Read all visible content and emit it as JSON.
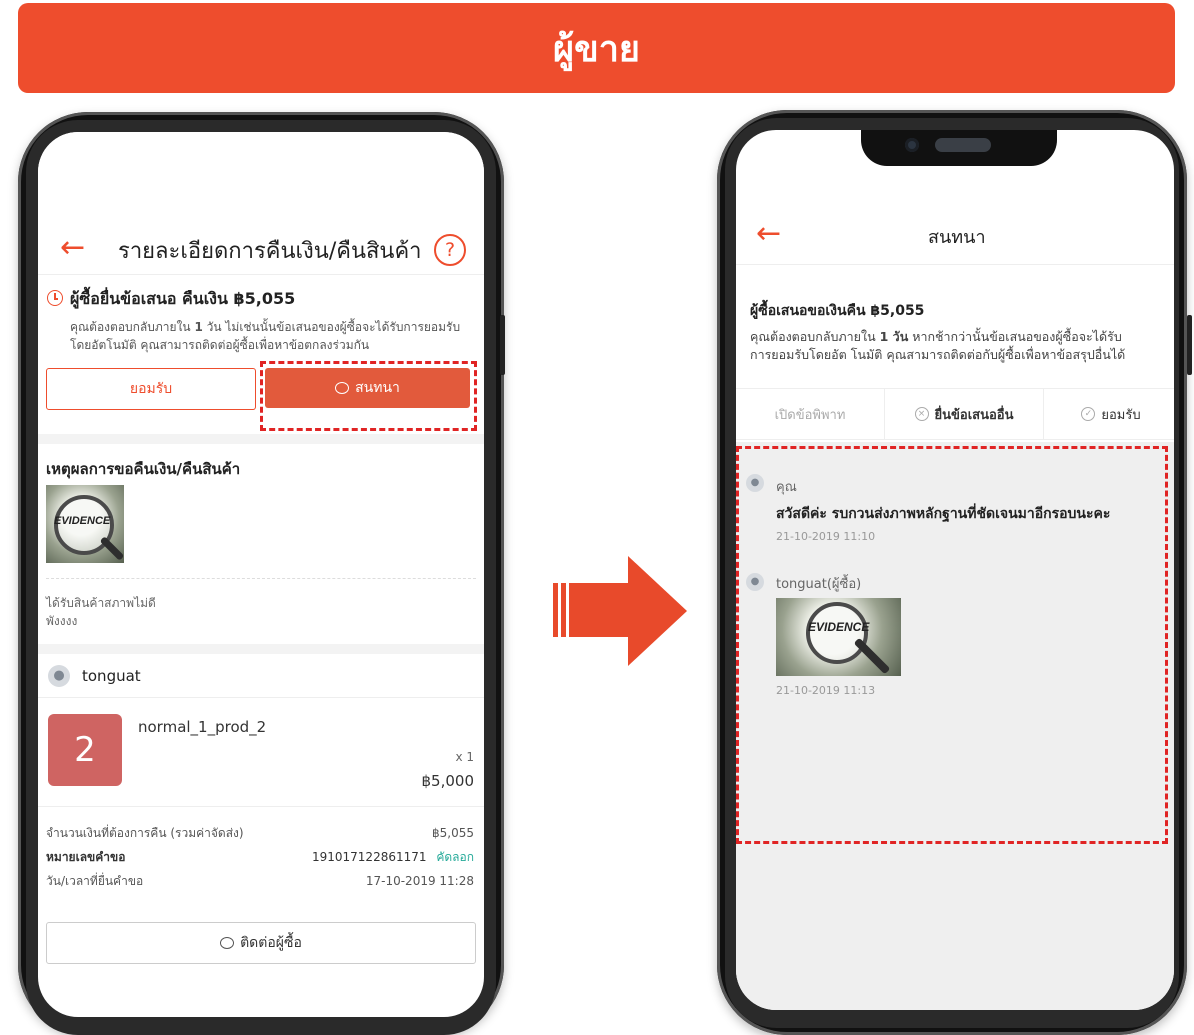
{
  "banner": {
    "title": "ผู้ขาย"
  },
  "left": {
    "header": {
      "title": "รายละเอียดการคืนเงิน/คืนสินค้า",
      "help_label": "?"
    },
    "status": {
      "title": "ผู้ซื้อยื่นข้อเสนอ คืนเงิน ฿5,055",
      "desc_line1_a": "คุณต้องตอบกลับภายใน ",
      "desc_days": "1",
      "desc_line1_b": " วัน ไม่เช่นนั้นข้อเสนอของผู้ซื้อจะได้รับการยอมรับ",
      "desc_line2": "โดยอัตโนมัติ คุณสามารถติดต่อผู้ซื้อเพื่อหาข้อตกลงร่วมกัน"
    },
    "buttons": {
      "accept": "ยอมรับ",
      "chat": "สนทนา"
    },
    "reason": {
      "heading": "เหตุผลการขอคืนเงิน/คืนสินค้า",
      "evidence_text": "EVIDENCE",
      "line1": "ได้รับสินค้าสภาพไม่ดี",
      "line2": "พังงงง"
    },
    "buyer": {
      "name": "tonguat"
    },
    "product": {
      "thumb_label": "2",
      "name": "normal_1_prod_2",
      "qty": "x 1",
      "price": "฿5,000"
    },
    "summary": {
      "refund_label": "จำนวนเงินที่ต้องการคืน (รวมค่าจัดส่ง)",
      "refund_value": "฿5,055",
      "request_label": "หมายเลขคำขอ",
      "request_value": "191017122861171",
      "copy_label": "คัดลอก",
      "time_label": "วัน/เวลาที่ยื่นคำขอ",
      "time_value": "17-10-2019 11:28"
    },
    "contact_button": "ติดต่อผู้ซื้อ"
  },
  "right": {
    "header": {
      "title": "สนทนา"
    },
    "offer": {
      "title": "ผู้ซื้อเสนอขอเงินคืน ฿5,055",
      "desc_line1_a": "คุณต้องตอบกลับภายใน ",
      "desc_days": "1 วัน",
      "desc_line1_b": " หากช้ากว่านั้นข้อเสนอของผู้ซื้อจะได้รับ",
      "desc_line2": "การยอมรับโดยอัต โนมัติ คุณสามารถติดต่อกับผู้ซื้อเพื่อหาข้อสรุปอื่นได้"
    },
    "tabs": {
      "dispute": "เปิดข้อพิพาท",
      "counter": "ยื่นข้อเสนออื่น",
      "accept": "ยอมรับ"
    },
    "messages": [
      {
        "sender": "คุณ",
        "text": "สวัสดีค่ะ รบกวนส่งภาพหลักฐานที่ชัดเจนมาอีกรอบนะคะ",
        "time": "21-10-2019 11:10"
      },
      {
        "sender": "tonguat(ผู้ซื้อ)",
        "image_text": "EVIDENCE",
        "time": "21-10-2019 11:13"
      }
    ]
  },
  "colors": {
    "brand": "#ee4d2d",
    "highlight_dash": "#e02424",
    "copy_link": "#26aa99"
  }
}
